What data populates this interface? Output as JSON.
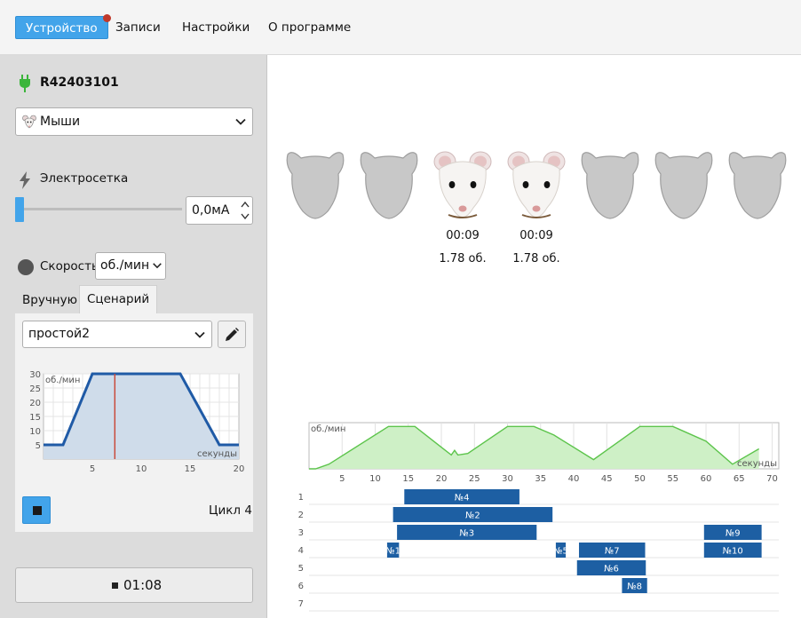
{
  "menu": {
    "items": [
      {
        "label": "Устройство",
        "active": true
      },
      {
        "label": "Записи"
      },
      {
        "label": "Настройки"
      },
      {
        "label": "О программе"
      }
    ]
  },
  "device": {
    "id": "R42403101"
  },
  "animal_select": {
    "value": "Мыши"
  },
  "shock": {
    "label": "Электросетка",
    "value": "0,0мА",
    "level": 0
  },
  "speed": {
    "label": "Скорость",
    "unit": "об./мин"
  },
  "tabs": [
    {
      "label": "Вручную"
    },
    {
      "label": "Сценарий",
      "active": true
    }
  ],
  "scenario": {
    "name": "простой2",
    "cycle_label": "Цикл 4",
    "chart_data": {
      "type": "area",
      "x": [
        0,
        2,
        5,
        14,
        18,
        20
      ],
      "y": [
        5,
        5,
        30,
        30,
        5,
        5
      ],
      "xlim": [
        0,
        20
      ],
      "ylim": [
        0,
        30
      ],
      "x_ticks": [
        5,
        10,
        15,
        20
      ],
      "y_ticks": [
        5,
        10,
        15,
        20,
        25,
        30
      ],
      "ylabel": "об./мин",
      "xlabel": "секунды",
      "marker_x": 7.3,
      "grid": true
    }
  },
  "timer": {
    "value": "01:08"
  },
  "mice": [
    {
      "active": false
    },
    {
      "active": false
    },
    {
      "active": true,
      "time": "00:09",
      "rev": "1.78 об."
    },
    {
      "active": true,
      "time": "00:09",
      "rev": "1.78 об."
    },
    {
      "active": false
    },
    {
      "active": false
    },
    {
      "active": false
    }
  ],
  "speed_chart": {
    "chart_data": {
      "type": "area",
      "x": [
        0,
        1,
        3,
        12,
        16,
        20,
        21.5,
        22,
        22.5,
        24,
        30,
        34,
        37,
        43,
        50,
        55,
        60,
        64,
        68
      ],
      "y": [
        0,
        0,
        3,
        27.5,
        27.5,
        14,
        9,
        12,
        9,
        10,
        27.5,
        27.5,
        22,
        6,
        27.5,
        27.5,
        18,
        3,
        13
      ],
      "xlim": [
        0,
        71
      ],
      "ylim": [
        0,
        30
      ],
      "x_ticks": [
        5,
        10,
        15,
        20,
        25,
        30,
        35,
        40,
        45,
        50,
        55,
        60,
        65,
        70
      ],
      "ylabel": "об./мин",
      "xlabel": "секунды",
      "grid": true
    }
  },
  "timeline": {
    "rows": [
      "1",
      "2",
      "3",
      "4",
      "5",
      "6",
      "7"
    ],
    "segments": [
      {
        "row": 1,
        "label": "№4",
        "start": 14.4,
        "end": 31.8
      },
      {
        "row": 2,
        "label": "№2",
        "start": 12.7,
        "end": 36.8
      },
      {
        "row": 3,
        "label": "№3",
        "start": 13.3,
        "end": 34.4
      },
      {
        "row": 3,
        "label": "№9",
        "start": 59.7,
        "end": 68.4
      },
      {
        "row": 4,
        "label": "№1",
        "start": 11.8,
        "end": 13.6
      },
      {
        "row": 4,
        "label": "№5",
        "start": 37.3,
        "end": 38.8
      },
      {
        "row": 4,
        "label": "№7",
        "start": 40.8,
        "end": 50.8
      },
      {
        "row": 4,
        "label": "№10",
        "start": 59.7,
        "end": 68.4
      },
      {
        "row": 5,
        "label": "№6",
        "start": 40.5,
        "end": 50.9
      },
      {
        "row": 6,
        "label": "№8",
        "start": 47.3,
        "end": 51.1
      }
    ]
  }
}
